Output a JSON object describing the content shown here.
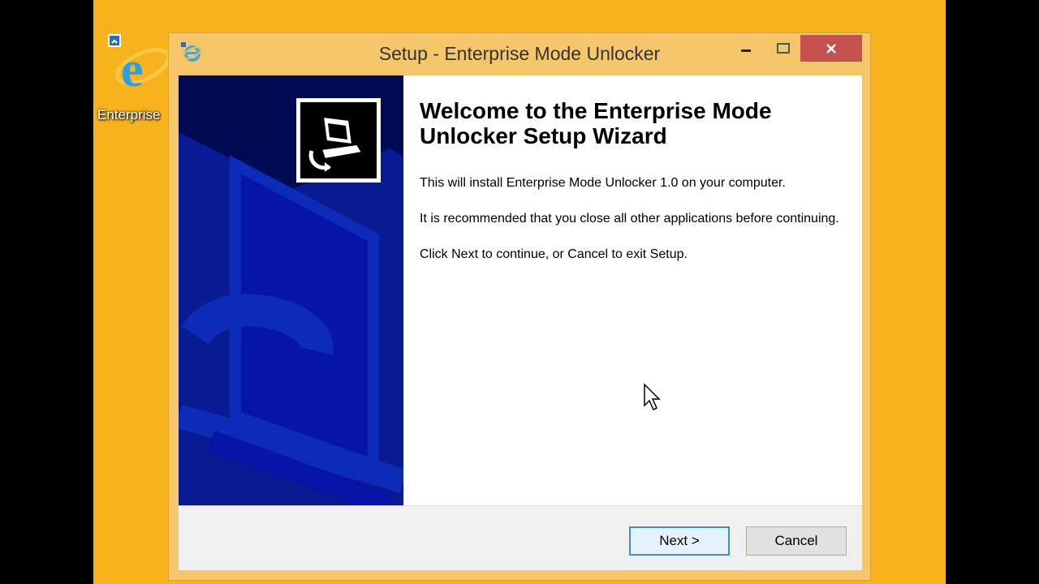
{
  "desktop": {
    "icon_label": "Enterprise",
    "background_color": "#f7b21c"
  },
  "window": {
    "title": "Setup - Enterprise Mode Unlocker",
    "controls": {
      "minimize": "minimize-icon",
      "maximize": "maximize-icon",
      "close": "close-icon"
    }
  },
  "wizard": {
    "heading": "Welcome to the Enterprise Mode Unlocker Setup Wizard",
    "paragraph1": "This will install Enterprise Mode Unlocker 1.0 on your computer.",
    "paragraph2": "It is recommended that you close all other applications before continuing.",
    "paragraph3": "Click Next to continue, or Cancel to exit Setup."
  },
  "buttons": {
    "next": "Next >",
    "cancel": "Cancel"
  }
}
